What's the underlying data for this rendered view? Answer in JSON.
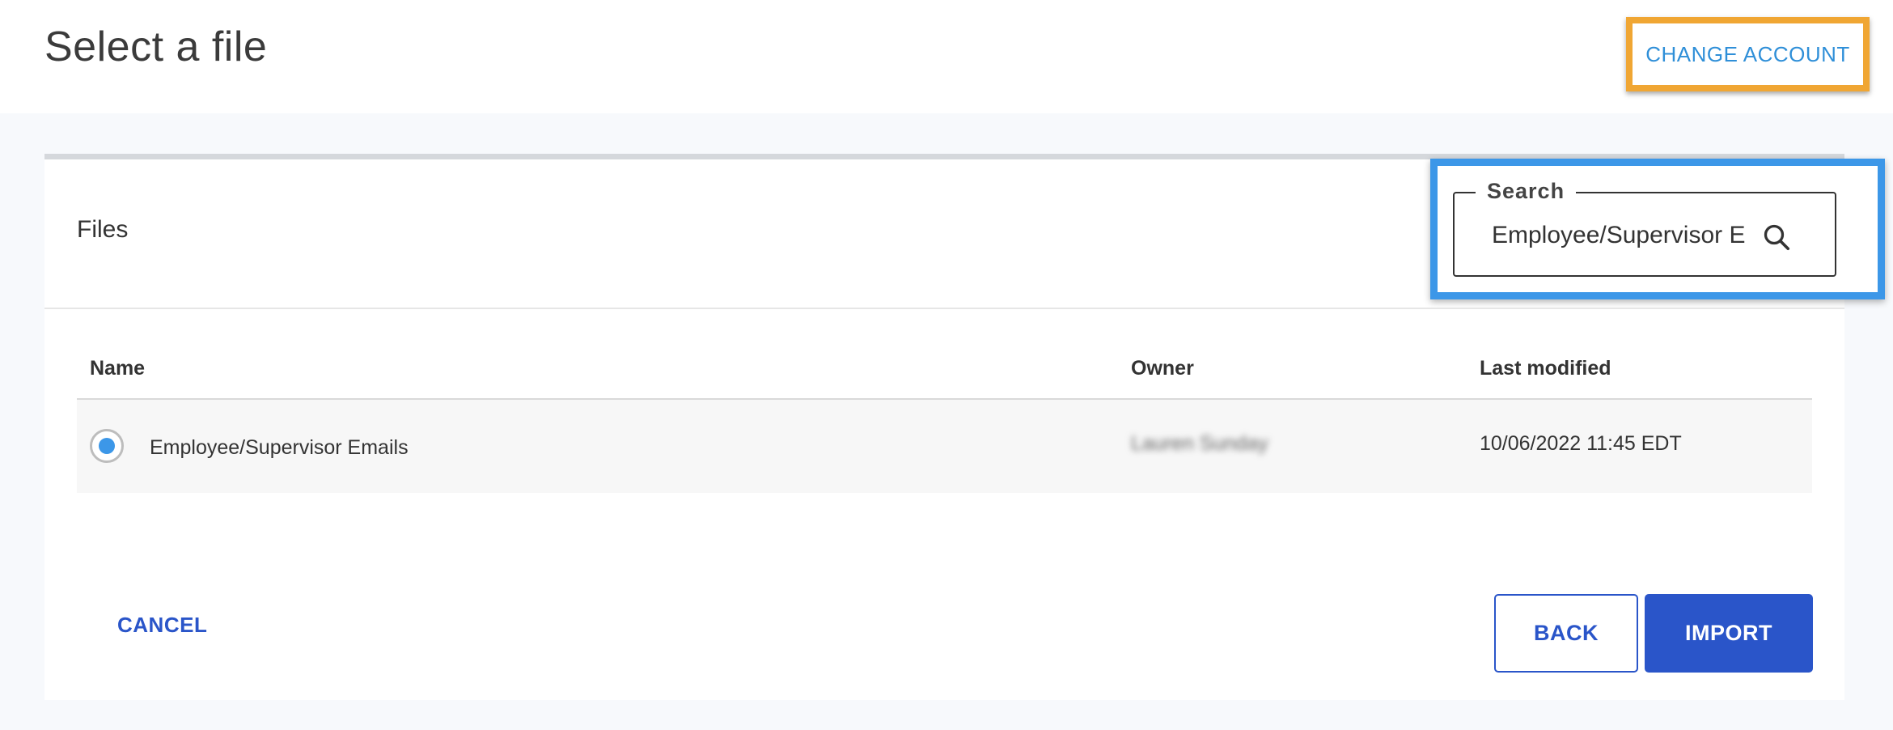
{
  "header": {
    "title": "Select a file",
    "change_account_label": "CHANGE ACCOUNT"
  },
  "files_section": {
    "label": "Files"
  },
  "search": {
    "legend": "Search",
    "value": "Employee/Supervisor E",
    "icon": "search-icon"
  },
  "table": {
    "columns": [
      "Name",
      "Owner",
      "Last modified"
    ],
    "rows": [
      {
        "selected": true,
        "name": "Employee/Supervisor Emails",
        "owner": "Lauren Sunday",
        "last_modified": "10/06/2022 11:45 EDT"
      }
    ]
  },
  "footer": {
    "cancel_label": "CANCEL",
    "back_label": "BACK",
    "import_label": "IMPORT"
  },
  "colors": {
    "highlight_orange": "#f0a633",
    "highlight_blue": "#3c97e8",
    "primary_blue": "#2a55c9",
    "link_blue": "#2f8fd8"
  }
}
